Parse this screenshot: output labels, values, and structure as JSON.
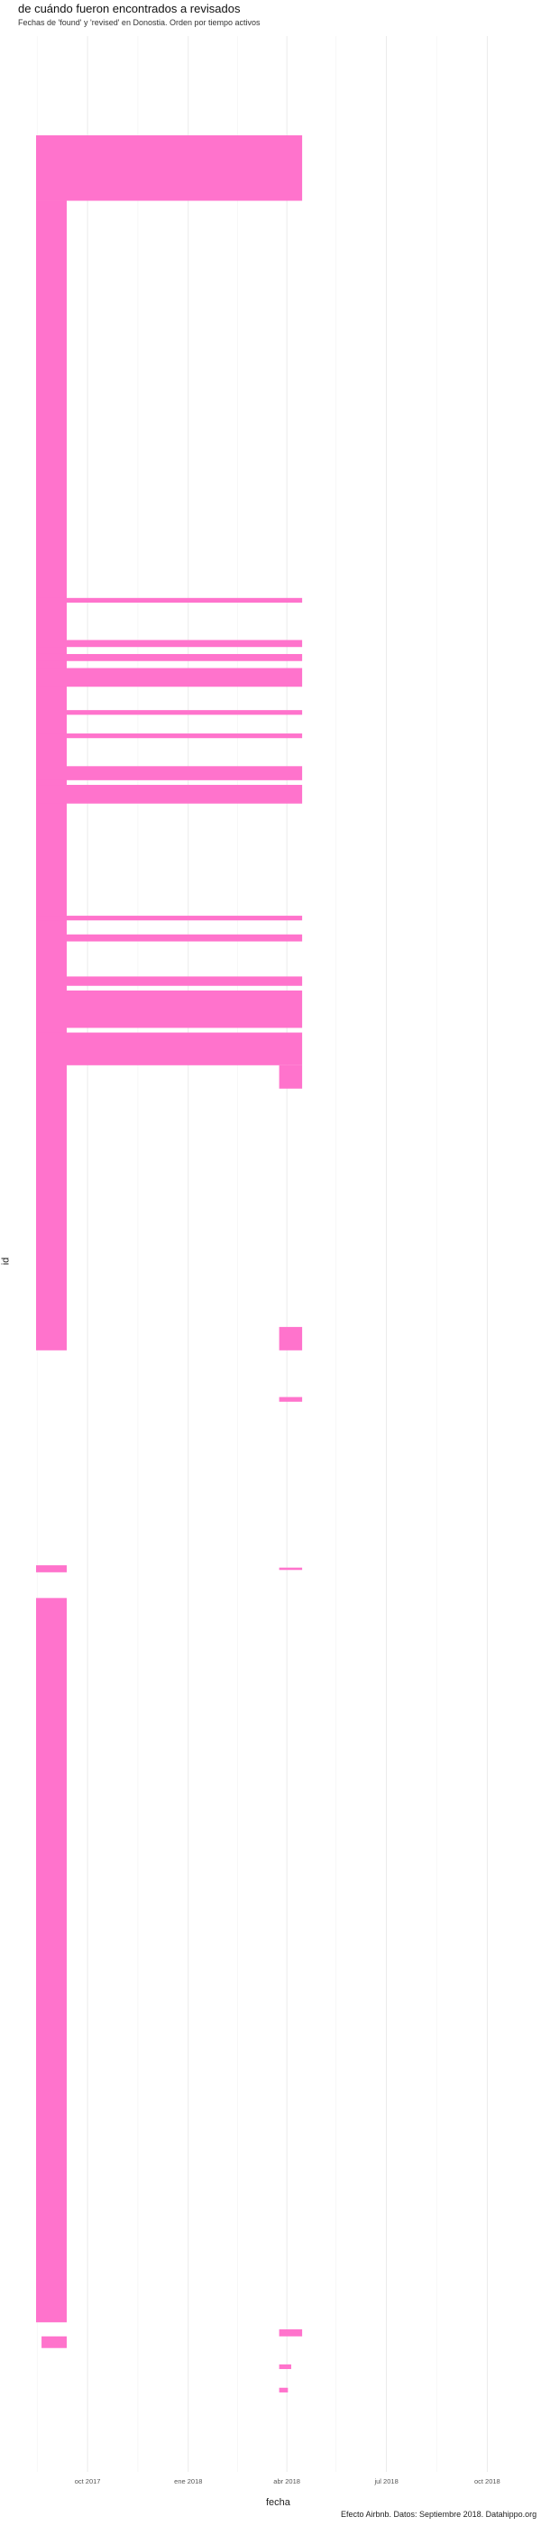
{
  "chart_data": {
    "type": "bar",
    "title": "de cuándo fueron encontrados a revisados",
    "subtitle": "Fechas de 'found' y 'revised' en Donostia. Orden por tiempo activos",
    "xlabel": "fecha",
    "ylabel": "id",
    "caption": "Efecto Airbnb. Datos: Septiembre 2018. Datahippo.org",
    "x_ticks": [
      "oct 2017",
      "ene 2018",
      "abr 2018",
      "jul 2018",
      "oct 2018"
    ],
    "xlim": [
      "2017-08-15",
      "2018-11-15"
    ],
    "grid": true,
    "bar_color": "#ff73cc",
    "segments": [
      {
        "start": "2017-08-15",
        "end": "2018-04-15",
        "row_from": 0.0,
        "row_to": 0.028
      },
      {
        "start": "2017-08-15",
        "end": "2017-09-12",
        "row_from": 0.028,
        "row_to": 0.52
      },
      {
        "start": "2017-08-15",
        "end": "2018-04-15",
        "row_from": 0.198,
        "row_to": 0.2
      },
      {
        "start": "2017-08-15",
        "end": "2018-04-15",
        "row_from": 0.216,
        "row_to": 0.219
      },
      {
        "start": "2017-08-15",
        "end": "2018-04-15",
        "row_from": 0.222,
        "row_to": 0.225
      },
      {
        "start": "2017-08-15",
        "end": "2018-04-15",
        "row_from": 0.228,
        "row_to": 0.236
      },
      {
        "start": "2017-08-15",
        "end": "2018-04-15",
        "row_from": 0.246,
        "row_to": 0.248
      },
      {
        "start": "2017-08-15",
        "end": "2018-04-15",
        "row_from": 0.256,
        "row_to": 0.258
      },
      {
        "start": "2017-08-15",
        "end": "2018-04-15",
        "row_from": 0.27,
        "row_to": 0.276
      },
      {
        "start": "2017-08-15",
        "end": "2018-04-15",
        "row_from": 0.278,
        "row_to": 0.286
      },
      {
        "start": "2017-08-15",
        "end": "2018-04-15",
        "row_from": 0.334,
        "row_to": 0.336
      },
      {
        "start": "2017-08-15",
        "end": "2018-04-15",
        "row_from": 0.342,
        "row_to": 0.345
      },
      {
        "start": "2017-08-15",
        "end": "2018-04-15",
        "row_from": 0.36,
        "row_to": 0.364
      },
      {
        "start": "2017-08-15",
        "end": "2018-04-15",
        "row_from": 0.366,
        "row_to": 0.382
      },
      {
        "start": "2017-08-15",
        "end": "2018-04-15",
        "row_from": 0.384,
        "row_to": 0.398
      },
      {
        "start": "2018-03-25",
        "end": "2018-04-15",
        "row_from": 0.398,
        "row_to": 0.408
      },
      {
        "start": "2018-03-25",
        "end": "2018-04-15",
        "row_from": 0.51,
        "row_to": 0.52
      },
      {
        "start": "2018-03-25",
        "end": "2018-04-15",
        "row_from": 0.54,
        "row_to": 0.542
      },
      {
        "start": "2017-08-15",
        "end": "2017-09-12",
        "row_from": 0.612,
        "row_to": 0.615
      },
      {
        "start": "2018-03-25",
        "end": "2018-04-15",
        "row_from": 0.613,
        "row_to": 0.614
      },
      {
        "start": "2017-08-15",
        "end": "2017-09-12",
        "row_from": 0.626,
        "row_to": 0.936
      },
      {
        "start": "2018-03-25",
        "end": "2018-04-15",
        "row_from": 0.939,
        "row_to": 0.942
      },
      {
        "start": "2017-08-20",
        "end": "2017-09-12",
        "row_from": 0.942,
        "row_to": 0.947
      },
      {
        "start": "2018-03-25",
        "end": "2018-04-05",
        "row_from": 0.954,
        "row_to": 0.956
      },
      {
        "start": "2018-03-25",
        "end": "2018-04-02",
        "row_from": 0.964,
        "row_to": 0.966
      }
    ]
  }
}
